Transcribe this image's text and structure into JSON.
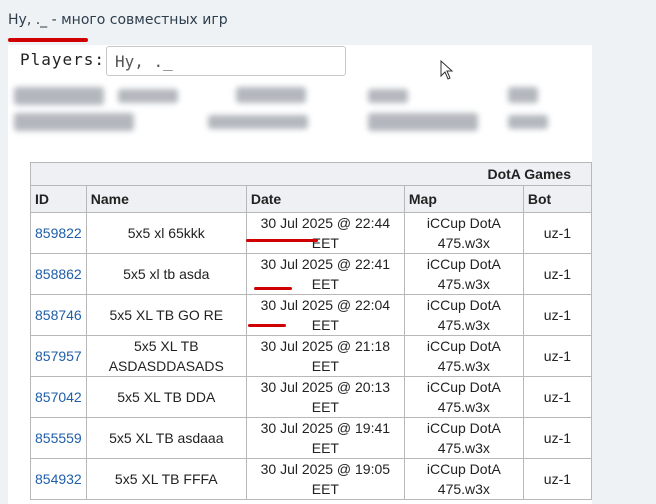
{
  "caption": "Ну, ._ - много совместных игр",
  "search": {
    "label": "Players:",
    "value": "Ну, ._"
  },
  "table": {
    "group_header": "DotA Games",
    "columns": [
      "ID",
      "Name",
      "Date",
      "Map",
      "Bot"
    ],
    "rows": [
      {
        "id": "859822",
        "name": "5x5 xl 65kkk",
        "date": "30 Jul 2025 @ 22:44 EET",
        "map": "iCCup DotA 475.w3x",
        "bot": "uz-1"
      },
      {
        "id": "858862",
        "name": "5x5 xl tb asda",
        "date": "30 Jul 2025 @ 22:41 EET",
        "map": "iCCup DotA 475.w3x",
        "bot": "uz-1"
      },
      {
        "id": "858746",
        "name": "5x5 XL TB GO RE",
        "date": "30 Jul 2025 @ 22:04 EET",
        "map": "iCCup DotA 475.w3x",
        "bot": "uz-1"
      },
      {
        "id": "857957",
        "name": "5x5 XL TB ASDASDDASADS",
        "date": "30 Jul 2025 @ 21:18 EET",
        "map": "iCCup DotA 475.w3x",
        "bot": "uz-1"
      },
      {
        "id": "857042",
        "name": "5x5 XL TB DDA",
        "date": "30 Jul 2025 @ 20:13 EET",
        "map": "iCCup DotA 475.w3x",
        "bot": "uz-1"
      },
      {
        "id": "855559",
        "name": "5x5 XL TB asdaaa",
        "date": "30 Jul 2025 @ 19:41 EET",
        "map": "iCCup DotA 475.w3x",
        "bot": "uz-1"
      },
      {
        "id": "854932",
        "name": "5x5 XL TB FFFA",
        "date": "30 Jul 2025 @ 19:05 EET",
        "map": "iCCup DotA 475.w3x",
        "bot": "uz-1"
      }
    ]
  },
  "colors": {
    "link": "#1f5ea8",
    "annotation": "#d00000",
    "header_bg": "#eef0f3"
  }
}
